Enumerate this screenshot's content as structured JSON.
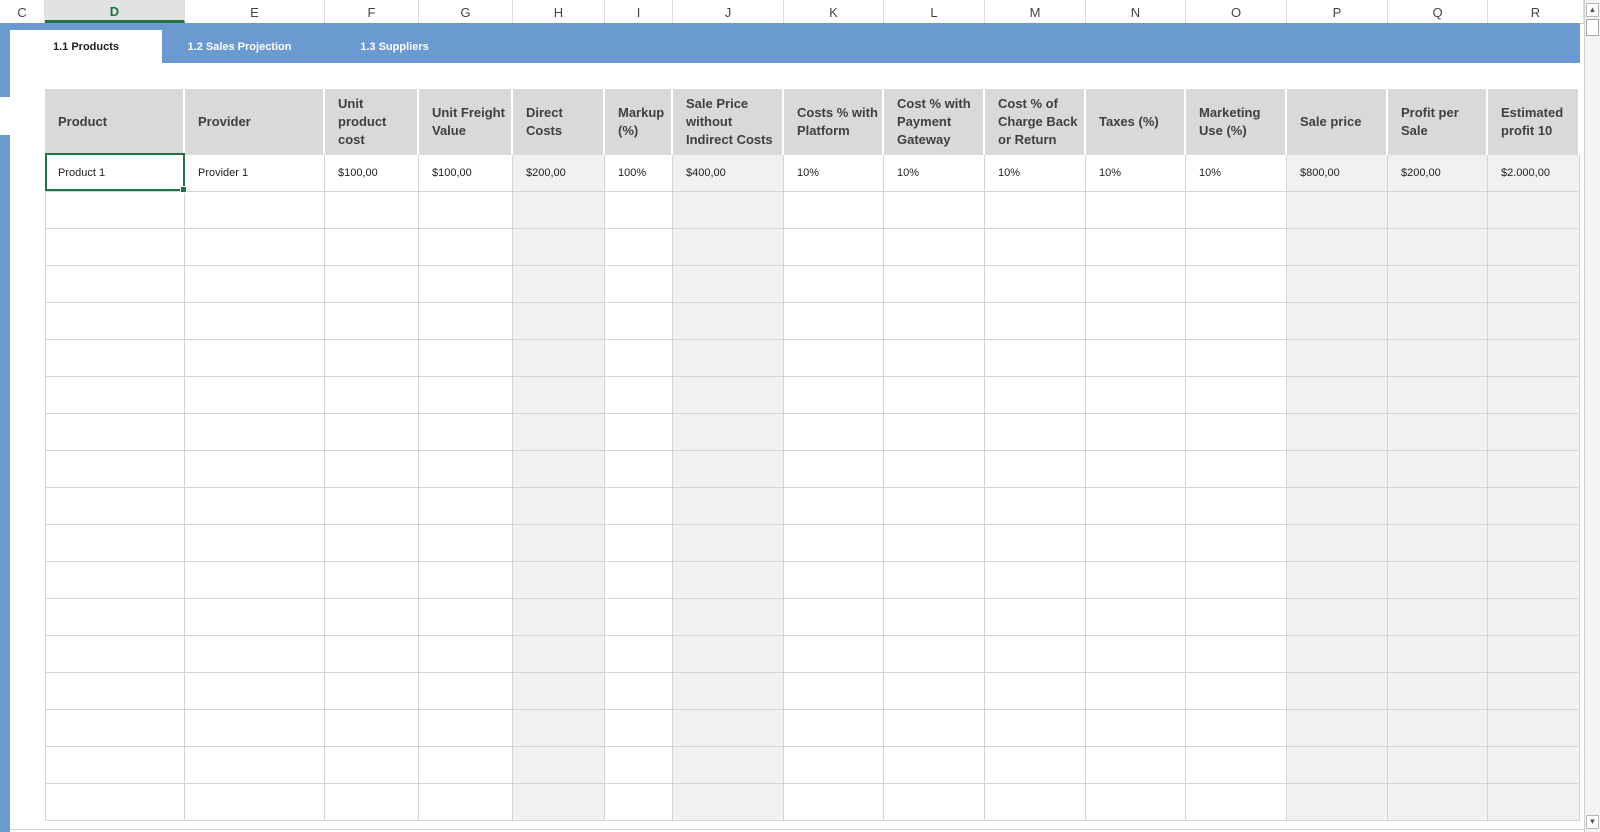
{
  "columns": [
    "C",
    "D",
    "E",
    "F",
    "G",
    "H",
    "I",
    "J",
    "K",
    "L",
    "M",
    "N",
    "O",
    "P",
    "Q",
    "R"
  ],
  "active_column": "D",
  "tabs": [
    {
      "label": "1.1 Products",
      "active": true
    },
    {
      "label": "1.2 Sales Projection",
      "active": false
    },
    {
      "label": "1.3 Suppliers",
      "active": false
    }
  ],
  "table": {
    "headers": [
      "Product",
      "Provider",
      "Unit product cost",
      "Unit Freight Value",
      "Direct Costs",
      "Markup (%)",
      "Sale Price without Indirect Costs",
      "Costs % with Platform",
      "Cost % with Payment Gateway",
      "Cost % of Charge Back or Return",
      "Taxes (%)",
      "Marketing Use (%)",
      "Sale price",
      "Profit per Sale",
      "Estimated profit 10"
    ],
    "rows": [
      [
        "Product 1",
        "Provider 1",
        "$100,00",
        "$100,00",
        "$200,00",
        "100%",
        "$400,00",
        "10%",
        "10%",
        "10%",
        "10%",
        "10%",
        "$800,00",
        "$200,00",
        "$2.000,00"
      ]
    ],
    "empty_rows": 17,
    "shaded_columns": [
      4,
      6,
      12,
      13,
      14
    ]
  },
  "colors": {
    "band": "#6b9ad1",
    "header_fill": "#d9d9d9",
    "computed_fill": "#f1f1f1",
    "selection": "#217346"
  },
  "icons": {
    "scroll_up": "triangle-up-icon",
    "scroll_down": "triangle-down-icon"
  }
}
